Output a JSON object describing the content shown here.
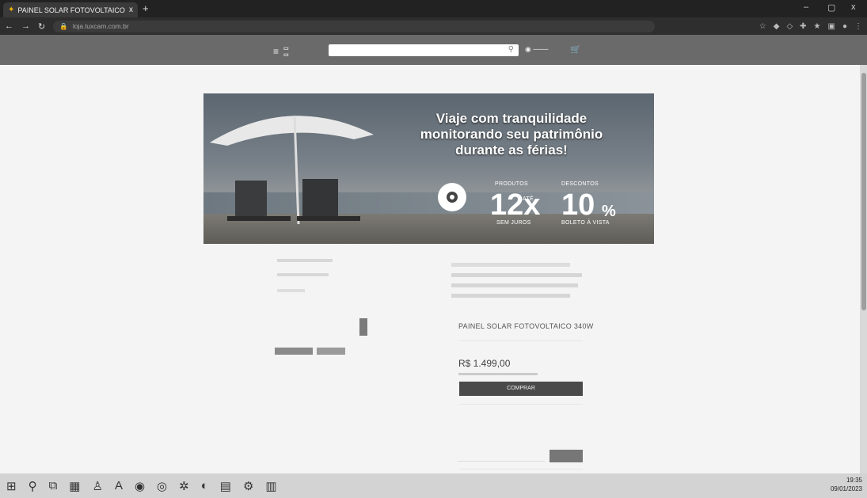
{
  "browser": {
    "tab_title": "PAINEL SOLAR FOTOVOLTAICO",
    "tab_close": "x",
    "new_tab": "+",
    "url": "loja.luxcam.com.br",
    "win_min": "–",
    "win_max": "▢",
    "win_close": "x"
  },
  "banner": {
    "line1": "Viaje com tranquilidade",
    "line2": "monitorando seu patrimônio",
    "line3": "durante as férias!",
    "produtos_label": "PRODUTOS",
    "ate_label": "ATÉ",
    "parcelas": "12x",
    "sem_juros": "SEM JUROS",
    "descontos_label": "DESCONTOS",
    "desconto_valor": "10",
    "pct": "%",
    "boleto_label": "BOLETO À VISTA"
  },
  "product": {
    "name": "PAINEL SOLAR FOTOVOLTAICO 340W",
    "price": "R$ 1.499,00",
    "buy_label": "COMPRAR"
  },
  "taskbar": {
    "time": "19:35",
    "date": "09/01/2023"
  },
  "colors": {
    "site_header": "#6a6a6a",
    "buy_button": "#4a4a4a",
    "browser_chrome": "#2e2e2e"
  },
  "icons": [
    "menu-icon",
    "search-icon",
    "user-icon",
    "cart-icon",
    "camera-icon",
    "windows-icon"
  ]
}
